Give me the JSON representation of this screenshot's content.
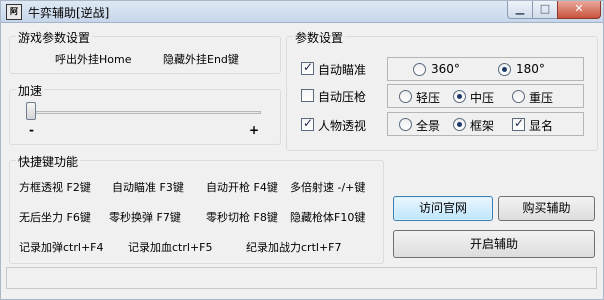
{
  "window": {
    "title": "牛弈辅助[逆战]",
    "icon_text": "阿里",
    "min_glyph": "▁",
    "max_glyph": "□",
    "close_glyph": "✕"
  },
  "game_params": {
    "legend": "游戏参数设置",
    "hotkey_show": "呼出外挂Home",
    "hotkey_hide": "隐藏外挂End键"
  },
  "speed": {
    "legend": "加速",
    "minus": "-",
    "plus": "+",
    "level": 0
  },
  "params": {
    "legend": "参数设置",
    "auto_aim": {
      "label": "自动瞄准",
      "checked": true
    },
    "auto_recoil": {
      "label": "自动压枪",
      "checked": false
    },
    "esp": {
      "label": "人物透视",
      "checked": true
    },
    "fov_options": [
      {
        "label": "360°",
        "selected": false
      },
      {
        "label": "180°",
        "selected": true
      }
    ],
    "recoil_options": [
      {
        "label": "轻压",
        "selected": false
      },
      {
        "label": "中压",
        "selected": true
      },
      {
        "label": "重压",
        "selected": false
      }
    ],
    "esp_options": [
      {
        "label": "全景",
        "selected": false
      },
      {
        "label": "框架",
        "selected": true
      }
    ],
    "show_name": {
      "label": "显名",
      "checked": true
    }
  },
  "shortcuts": {
    "legend": "快捷键功能",
    "rows": [
      [
        "方框透视 F2键",
        "自动瞄准 F3键",
        "自动开枪 F4键",
        "多倍射速 -/+键"
      ],
      [
        "无后坐力 F6键",
        "零秒换弹 F7键",
        "零秒切枪 F8键",
        "隐藏枪体F10键"
      ],
      [
        "记录加弹ctrl+F4",
        "记录加血ctrl+F5",
        "纪录加战力crtl+F7"
      ]
    ]
  },
  "buttons": {
    "website": "访问官网",
    "buy": "购买辅助",
    "start": "开启辅助"
  },
  "status": ""
}
